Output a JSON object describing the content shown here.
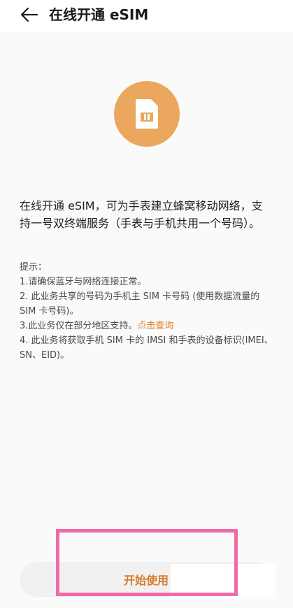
{
  "header": {
    "title": "在线开通 eSIM"
  },
  "intro_text": "在线开通 eSIM，可为手表建立蜂窝移动网络，支持一号双终端服务（手表与手机共用一个号码）。",
  "tips": {
    "heading": "提示：",
    "item1": "1.请确保蓝牙与网络连接正常。",
    "item2": "2. 此业务共享的号码为手机主 SIM 卡号码 (使用数据流量的 SIM 卡号码)。",
    "item3_text": "3.此业务仅在部分地区支持。",
    "item3_link": "点击查询",
    "item4": "4. 此业务将获取手机 SIM 卡的 IMSI 和手表的设备标识(IMEI、SN、EID)。"
  },
  "button": {
    "start_label": "开始使用"
  },
  "colors": {
    "accent_orange": "#eba75e",
    "link_orange": "#e0802a",
    "highlight_pink": "#f06aa8"
  },
  "icons": {
    "back": "arrow-left-icon",
    "sim": "sim-card-icon"
  }
}
